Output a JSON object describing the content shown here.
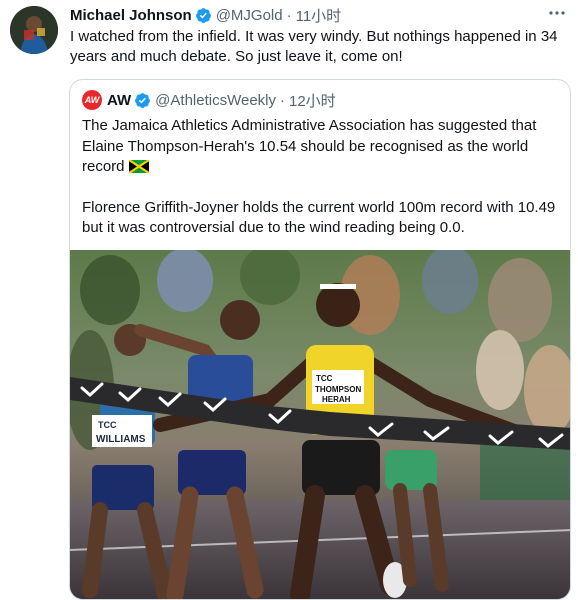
{
  "tweet": {
    "author_name": "Michael Johnson",
    "author_handle": "@MJGold",
    "time": "11小时",
    "more_icon": "more-dots-icon",
    "text": "I watched from the infield. It was very windy. But nothings happened in 34 years and much debate. So just leave it, come on!"
  },
  "quote": {
    "logo_text": "AW",
    "author_name": "AW",
    "author_handle": "@AthleticsWeekly",
    "time": "12小时",
    "paragraph1": "The Jamaica Athletics Administrative Association has suggested that Elaine Thompson-Herah's 10.54 should be recognised as the world record",
    "flag_icon": "jamaica-flag-icon",
    "paragraph2": "Florence Griffith-Joyner holds the current world 100m record with 10.49 but it was controversial due to the wind reading being 0.0.",
    "photo": {
      "bib_left": "WILLIAMS",
      "bib_center_top": "TCC",
      "bib_center_name": "THOMPSON",
      "bib_center_sub": "HERAH"
    }
  },
  "colors": {
    "verified": "#1d9bf0",
    "secondary_text": "#536471",
    "border": "#cfd9de",
    "aw_logo": "#e8282d"
  }
}
